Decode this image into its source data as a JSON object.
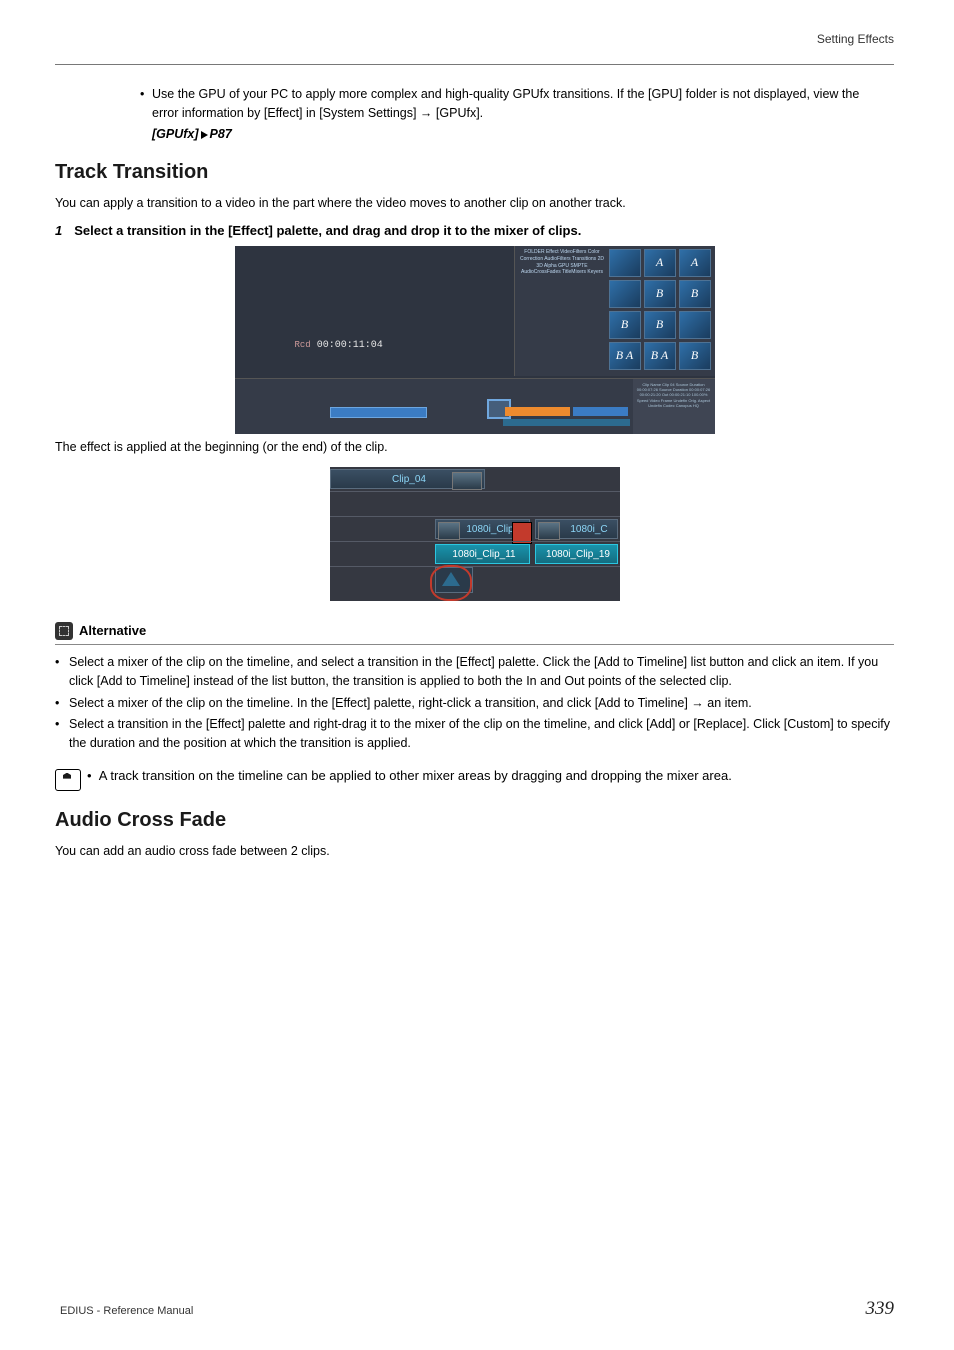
{
  "header": {
    "section": "Setting Effects"
  },
  "intro_bullet": {
    "text": "Use the GPU of your PC to apply more complex and high-quality GPUfx transitions. If the [GPU] folder is not displayed, view the error information by [Effect] in [System Settings] → [GPUfx].",
    "ref_label": "[GPUfx]",
    "ref_page": "P87"
  },
  "track_transition": {
    "heading": "Track Transition",
    "intro": "You can apply a transition to a video in the part where the video moves to another clip on another track.",
    "step_num": "1",
    "step_text": "Select a transition in the [Effect] palette, and drag and drop it to the mixer of clips.",
    "after_fig": "The effect is applied at the beginning (or the end) of the clip."
  },
  "fig1": {
    "timecode_label": "Rcd",
    "timecode": "00:00:11:04",
    "tree": "FOLDER\n  Effect\n    VideoFilters\n      Color Correction\n    AudioFilters\n    Transitions\n      2D\n      3D\n      Alpha\n      GPU\n      SMPTE\n    AudioCrossFades\n    TitleMixers\n    Keyers",
    "effects": [
      "",
      "A",
      "A",
      "",
      "B",
      "B",
      "B",
      "B",
      "",
      "B A",
      "B A",
      "B"
    ],
    "info_text": "Clip Name\nClip 04\nSource Duration 00:00:07:26\nSource Duration 00:00:07:26\n00:00:21:20\nOut 00:00:21:10\n100.00%\nSpeed\nVideo Frame Undefin\nOrig. Aspect Undefin\nCodec Canopus HQ"
  },
  "fig2": {
    "clip_top": "Clip_04",
    "mid_left": "1080i_Clip…",
    "mid_right": "1080i_C",
    "low_left": "1080i_Clip_11",
    "low_right": "1080i_Clip_19"
  },
  "alternative": {
    "title": "Alternative",
    "items": [
      "Select a mixer of the clip on the timeline, and select a transition in the [Effect] palette. Click the [Add to Timeline] list button and click an item. If you click [Add to Timeline] instead of the list button, the transition is applied to both the In and Out points of the selected clip.",
      "Select a mixer of the clip on the timeline. In the [Effect] palette, right-click a transition, and click [Add to Timeline] → an item.",
      "Select a transition in the [Effect] palette and right-drag it to the mixer of the clip on the timeline, and click [Add] or [Replace]. Click [Custom] to specify the duration and the position at which the transition is applied."
    ]
  },
  "note": {
    "text": "A track transition on the timeline can be applied to other mixer areas by dragging and dropping the mixer area."
  },
  "audio_cross_fade": {
    "heading": "Audio Cross Fade",
    "intro": "You can add an audio cross fade between 2 clips."
  },
  "footer": {
    "left": "EDIUS - Reference Manual",
    "page": "339"
  }
}
